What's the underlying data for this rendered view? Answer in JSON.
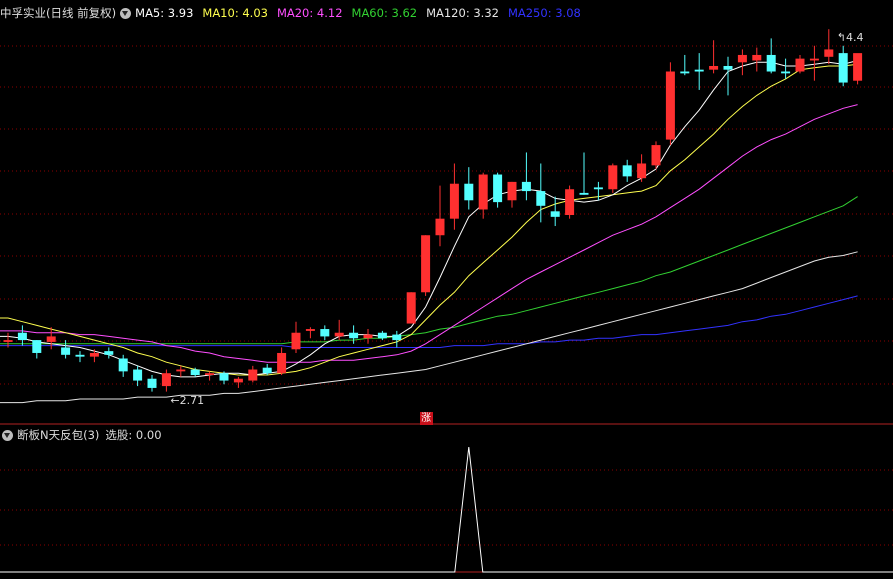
{
  "main_header": {
    "title": "中孚实业(日线 前复权)",
    "ma": [
      {
        "label": "MA5: 3.93",
        "color": "#ffffff"
      },
      {
        "label": "MA10: 4.03",
        "color": "#ffff4f"
      },
      {
        "label": "MA20: 4.12",
        "color": "#ff4fff"
      },
      {
        "label": "MA60: 3.62",
        "color": "#32d232"
      },
      {
        "label": "MA120: 3.32",
        "color": "#e6e6e6"
      },
      {
        "label": "MA250: 3.08",
        "color": "#3232ff"
      }
    ]
  },
  "annotations": {
    "low_label": "2.71",
    "high_label": "4.4",
    "limit_up_badge": "涨"
  },
  "indicator_header": {
    "title": "断板N天反包(3)",
    "value": "选股: 0.00"
  },
  "colors": {
    "up": "#ff3030",
    "down": "#54ffff",
    "grid": "#8b0000"
  },
  "chart_data": {
    "type": "candlestick",
    "ohlc": [
      [
        2.83,
        2.88,
        2.8,
        2.84
      ],
      [
        2.88,
        2.92,
        2.81,
        2.84
      ],
      [
        2.84,
        2.84,
        2.74,
        2.77
      ],
      [
        2.83,
        2.91,
        2.79,
        2.86
      ],
      [
        2.8,
        2.84,
        2.74,
        2.76
      ],
      [
        2.76,
        2.78,
        2.72,
        2.75
      ],
      [
        2.75,
        2.79,
        2.72,
        2.77
      ],
      [
        2.78,
        2.8,
        2.74,
        2.76
      ],
      [
        2.74,
        2.76,
        2.64,
        2.67
      ],
      [
        2.68,
        2.7,
        2.59,
        2.62
      ],
      [
        2.63,
        2.65,
        2.56,
        2.58
      ],
      [
        2.59,
        2.68,
        2.56,
        2.66
      ],
      [
        2.67,
        2.7,
        2.64,
        2.68
      ],
      [
        2.68,
        2.69,
        2.64,
        2.65
      ],
      [
        2.65,
        2.67,
        2.62,
        2.66
      ],
      [
        2.66,
        2.67,
        2.6,
        2.62
      ],
      [
        2.61,
        2.64,
        2.58,
        2.63
      ],
      [
        2.62,
        2.7,
        2.61,
        2.68
      ],
      [
        2.69,
        2.71,
        2.65,
        2.66
      ],
      [
        2.66,
        2.8,
        2.65,
        2.77
      ],
      [
        2.79,
        2.94,
        2.77,
        2.88
      ],
      [
        2.89,
        2.91,
        2.85,
        2.9
      ],
      [
        2.9,
        2.92,
        2.84,
        2.86
      ],
      [
        2.86,
        2.95,
        2.84,
        2.88
      ],
      [
        2.88,
        2.92,
        2.82,
        2.85
      ],
      [
        2.85,
        2.9,
        2.82,
        2.87
      ],
      [
        2.88,
        2.89,
        2.84,
        2.85
      ],
      [
        2.87,
        2.89,
        2.8,
        2.84
      ],
      [
        2.93,
        3.1,
        2.93,
        3.1
      ],
      [
        3.1,
        3.41,
        3.08,
        3.41
      ],
      [
        3.41,
        3.68,
        3.35,
        3.5
      ],
      [
        3.5,
        3.8,
        3.44,
        3.69
      ],
      [
        3.69,
        3.78,
        3.55,
        3.6
      ],
      [
        3.55,
        3.75,
        3.5,
        3.74
      ],
      [
        3.74,
        3.75,
        3.56,
        3.59
      ],
      [
        3.6,
        3.7,
        3.56,
        3.7
      ],
      [
        3.7,
        3.86,
        3.6,
        3.65
      ],
      [
        3.65,
        3.8,
        3.48,
        3.57
      ],
      [
        3.54,
        3.62,
        3.46,
        3.51
      ],
      [
        3.52,
        3.68,
        3.5,
        3.66
      ],
      [
        3.64,
        3.86,
        3.63,
        3.63
      ],
      [
        3.67,
        3.7,
        3.6,
        3.66
      ],
      [
        3.66,
        3.8,
        3.64,
        3.79
      ],
      [
        3.79,
        3.82,
        3.7,
        3.73
      ],
      [
        3.72,
        3.85,
        3.7,
        3.8
      ],
      [
        3.79,
        3.92,
        3.77,
        3.9
      ],
      [
        3.93,
        4.35,
        3.9,
        4.3
      ],
      [
        4.3,
        4.39,
        4.28,
        4.29
      ],
      [
        4.31,
        4.4,
        4.2,
        4.3
      ],
      [
        4.31,
        4.47,
        4.29,
        4.33
      ],
      [
        4.33,
        4.38,
        4.17,
        4.31
      ],
      [
        4.35,
        4.42,
        4.28,
        4.39
      ],
      [
        4.36,
        4.43,
        4.3,
        4.39
      ],
      [
        4.39,
        4.48,
        4.29,
        4.3
      ],
      [
        4.3,
        4.37,
        4.26,
        4.29
      ],
      [
        4.3,
        4.39,
        4.29,
        4.37
      ],
      [
        4.36,
        4.44,
        4.25,
        4.37
      ],
      [
        4.38,
        4.53,
        4.34,
        4.42
      ],
      [
        4.4,
        4.44,
        4.22,
        4.24
      ],
      [
        4.25,
        4.37,
        4.23,
        4.4
      ]
    ],
    "ma5": [
      2.86,
      2.85,
      2.83,
      2.82,
      2.81,
      2.8,
      2.78,
      2.76,
      2.73,
      2.7,
      2.67,
      2.65,
      2.64,
      2.64,
      2.65,
      2.66,
      2.66,
      2.65,
      2.66,
      2.67,
      2.71,
      2.76,
      2.82,
      2.86,
      2.87,
      2.87,
      2.86,
      2.86,
      2.91,
      3.02,
      3.18,
      3.35,
      3.51,
      3.58,
      3.63,
      3.65,
      3.66,
      3.65,
      3.61,
      3.6,
      3.59,
      3.6,
      3.63,
      3.68,
      3.72,
      3.77,
      3.9,
      4.0,
      4.09,
      4.2,
      4.3,
      4.33,
      4.35,
      4.35,
      4.33,
      4.33,
      4.34,
      4.35,
      4.34,
      4.36
    ],
    "ma10": [
      2.96,
      2.94,
      2.92,
      2.9,
      2.88,
      2.86,
      2.84,
      2.82,
      2.8,
      2.77,
      2.75,
      2.72,
      2.7,
      2.68,
      2.67,
      2.66,
      2.65,
      2.65,
      2.65,
      2.66,
      2.67,
      2.69,
      2.72,
      2.75,
      2.77,
      2.79,
      2.81,
      2.83,
      2.87,
      2.95,
      3.03,
      3.1,
      3.19,
      3.26,
      3.33,
      3.4,
      3.48,
      3.55,
      3.58,
      3.6,
      3.61,
      3.62,
      3.63,
      3.64,
      3.65,
      3.68,
      3.76,
      3.82,
      3.89,
      3.96,
      4.04,
      4.11,
      4.17,
      4.22,
      4.26,
      4.31,
      4.32,
      4.33,
      4.33,
      4.34
    ],
    "ma20": [
      2.89,
      2.89,
      2.88,
      2.88,
      2.88,
      2.87,
      2.87,
      2.86,
      2.85,
      2.84,
      2.83,
      2.81,
      2.8,
      2.78,
      2.77,
      2.75,
      2.74,
      2.73,
      2.72,
      2.72,
      2.72,
      2.72,
      2.73,
      2.73,
      2.73,
      2.74,
      2.75,
      2.76,
      2.78,
      2.82,
      2.87,
      2.92,
      2.97,
      3.02,
      3.07,
      3.12,
      3.17,
      3.21,
      3.25,
      3.29,
      3.33,
      3.37,
      3.41,
      3.44,
      3.47,
      3.51,
      3.56,
      3.61,
      3.66,
      3.72,
      3.78,
      3.84,
      3.89,
      3.93,
      3.96,
      4.0,
      4.04,
      4.07,
      4.1,
      4.12
    ],
    "ma60": [
      2.82,
      2.82,
      2.82,
      2.82,
      2.82,
      2.82,
      2.82,
      2.82,
      2.82,
      2.82,
      2.82,
      2.82,
      2.82,
      2.82,
      2.82,
      2.82,
      2.82,
      2.82,
      2.82,
      2.82,
      2.83,
      2.83,
      2.83,
      2.84,
      2.84,
      2.85,
      2.85,
      2.86,
      2.87,
      2.88,
      2.9,
      2.91,
      2.93,
      2.95,
      2.97,
      2.98,
      3.0,
      3.02,
      3.04,
      3.06,
      3.08,
      3.1,
      3.12,
      3.14,
      3.16,
      3.19,
      3.21,
      3.24,
      3.27,
      3.3,
      3.33,
      3.36,
      3.39,
      3.42,
      3.45,
      3.48,
      3.51,
      3.54,
      3.57,
      3.62
    ],
    "ma120": [
      2.5,
      2.5,
      2.51,
      2.51,
      2.51,
      2.52,
      2.52,
      2.52,
      2.52,
      2.53,
      2.53,
      2.53,
      2.54,
      2.54,
      2.54,
      2.55,
      2.55,
      2.56,
      2.57,
      2.58,
      2.59,
      2.6,
      2.61,
      2.62,
      2.63,
      2.64,
      2.65,
      2.66,
      2.67,
      2.68,
      2.7,
      2.72,
      2.74,
      2.76,
      2.78,
      2.8,
      2.82,
      2.84,
      2.86,
      2.88,
      2.9,
      2.92,
      2.94,
      2.96,
      2.98,
      3.0,
      3.02,
      3.04,
      3.06,
      3.08,
      3.1,
      3.12,
      3.15,
      3.18,
      3.21,
      3.24,
      3.27,
      3.29,
      3.3,
      3.32
    ],
    "ma250": [
      2.81,
      2.81,
      2.81,
      2.81,
      2.81,
      2.81,
      2.81,
      2.81,
      2.81,
      2.81,
      2.81,
      2.81,
      2.81,
      2.81,
      2.81,
      2.81,
      2.81,
      2.81,
      2.81,
      2.81,
      2.8,
      2.8,
      2.8,
      2.8,
      2.8,
      2.8,
      2.8,
      2.8,
      2.8,
      2.8,
      2.8,
      2.81,
      2.81,
      2.81,
      2.82,
      2.82,
      2.82,
      2.83,
      2.83,
      2.84,
      2.84,
      2.85,
      2.85,
      2.86,
      2.87,
      2.87,
      2.88,
      2.89,
      2.9,
      2.91,
      2.92,
      2.94,
      2.95,
      2.97,
      2.98,
      3.0,
      3.02,
      3.04,
      3.06,
      3.08
    ],
    "signal": [
      0,
      0,
      0,
      0,
      0,
      0,
      0,
      0,
      0,
      0,
      0,
      0,
      0,
      0,
      0,
      0,
      0,
      0,
      0,
      0,
      0,
      0,
      0,
      0,
      0,
      0,
      0,
      0,
      0,
      0,
      0,
      0,
      1,
      0,
      0,
      0,
      0,
      0,
      0,
      0,
      0,
      0,
      0,
      0,
      0,
      0,
      0,
      0,
      0,
      0,
      0,
      0,
      0,
      0,
      0,
      0,
      0,
      0,
      0,
      0
    ],
    "low_index": 11,
    "high_index": 57,
    "limit_up_index": 29
  }
}
